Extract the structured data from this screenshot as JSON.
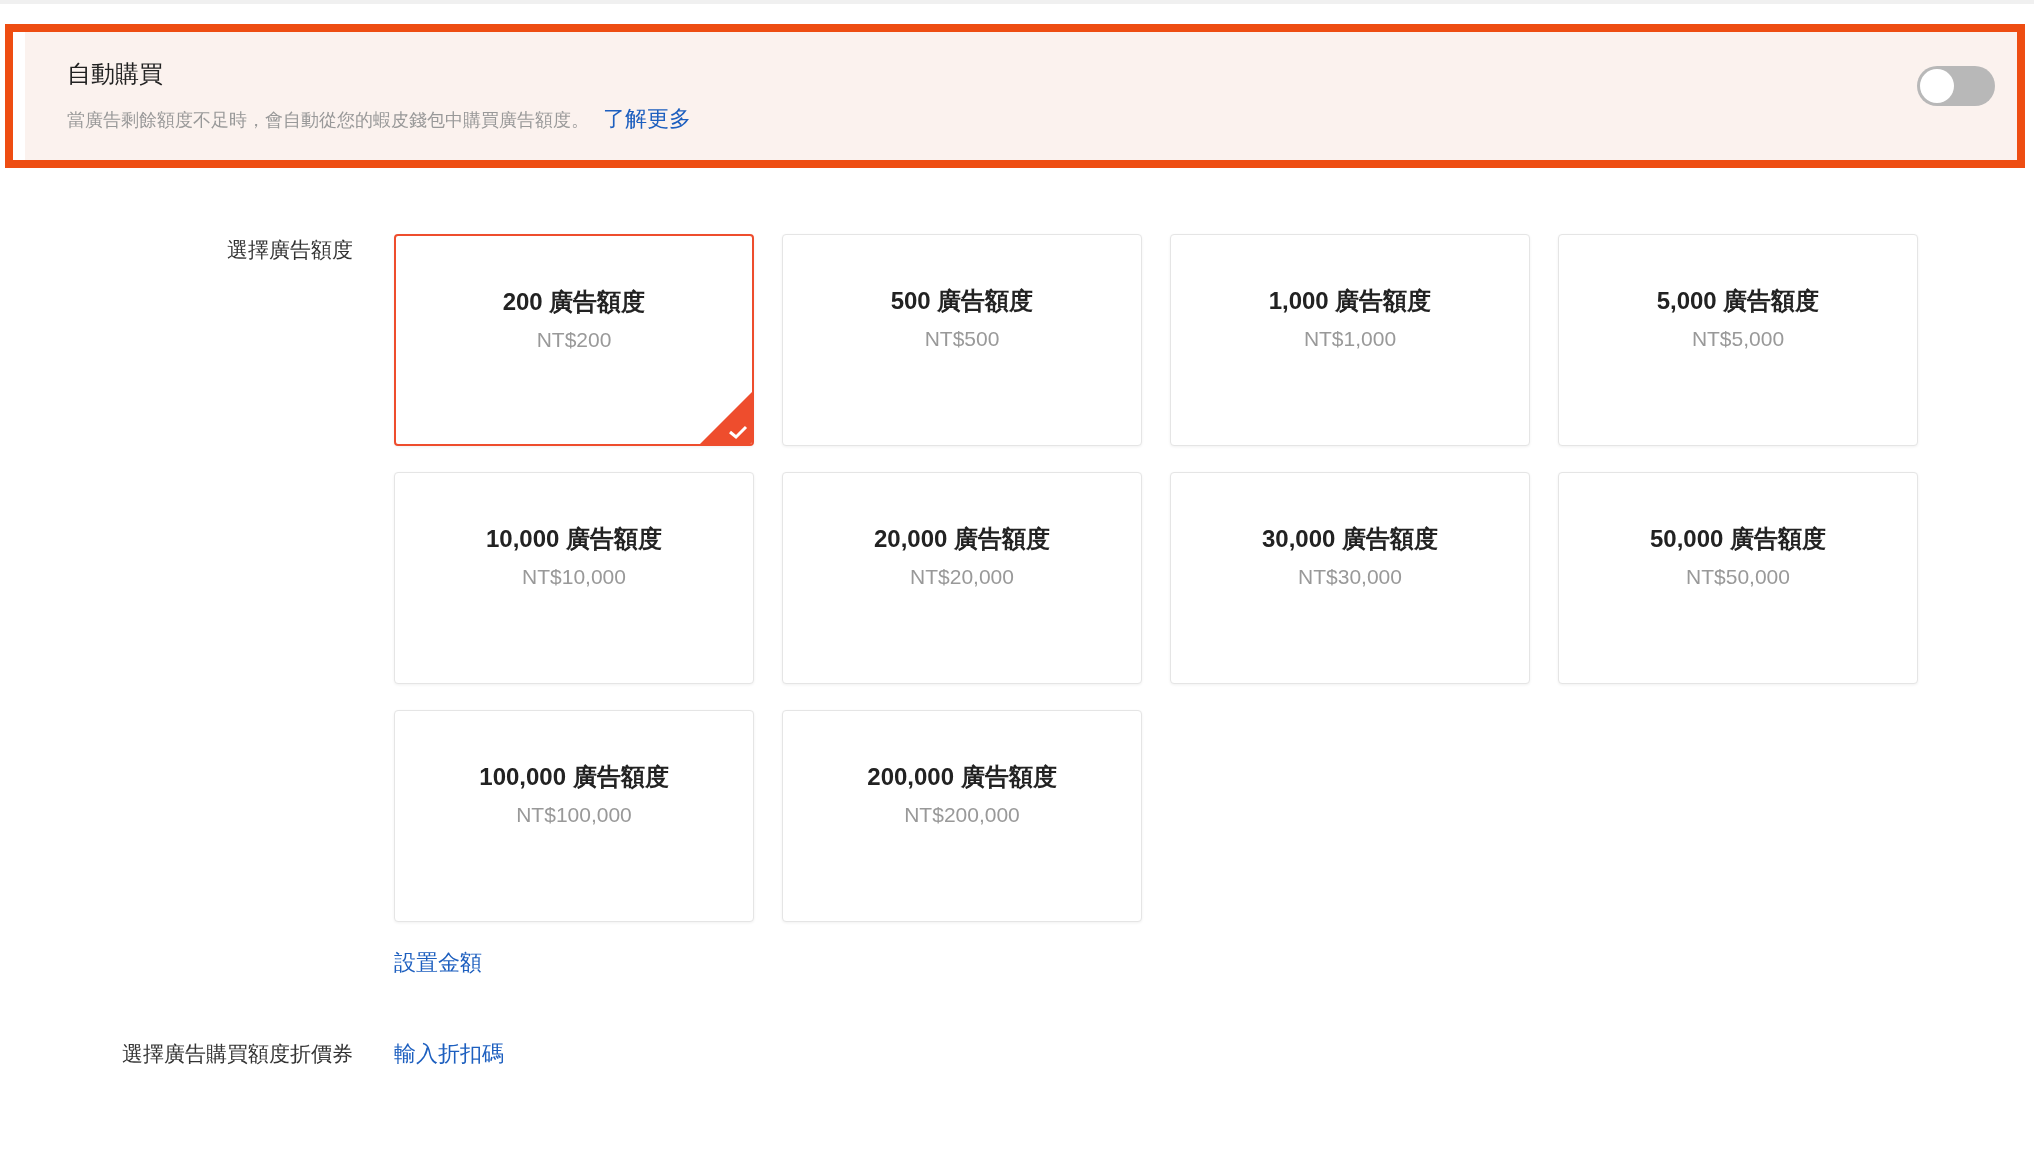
{
  "auto_purchase": {
    "title": "自動購買",
    "description": "當廣告剩餘額度不足時，會自動從您的蝦皮錢包中購買廣告額度。",
    "learn_more": "了解更多",
    "on": false
  },
  "credit_section": {
    "label": "選擇廣告額度",
    "options": [
      {
        "title": "200 廣告額度",
        "price": "NT$200",
        "selected": true
      },
      {
        "title": "500 廣告額度",
        "price": "NT$500",
        "selected": false
      },
      {
        "title": "1,000 廣告額度",
        "price": "NT$1,000",
        "selected": false
      },
      {
        "title": "5,000 廣告額度",
        "price": "NT$5,000",
        "selected": false
      },
      {
        "title": "10,000 廣告額度",
        "price": "NT$10,000",
        "selected": false
      },
      {
        "title": "20,000 廣告額度",
        "price": "NT$20,000",
        "selected": false
      },
      {
        "title": "30,000 廣告額度",
        "price": "NT$30,000",
        "selected": false
      },
      {
        "title": "50,000 廣告額度",
        "price": "NT$50,000",
        "selected": false
      },
      {
        "title": "100,000 廣告額度",
        "price": "NT$100,000",
        "selected": false
      },
      {
        "title": "200,000 廣告額度",
        "price": "NT$200,000",
        "selected": false
      }
    ],
    "custom_amount_link": "設置金額"
  },
  "voucher_section": {
    "label": "選擇廣告購買額度折價券",
    "link": "輸入折扣碼"
  }
}
